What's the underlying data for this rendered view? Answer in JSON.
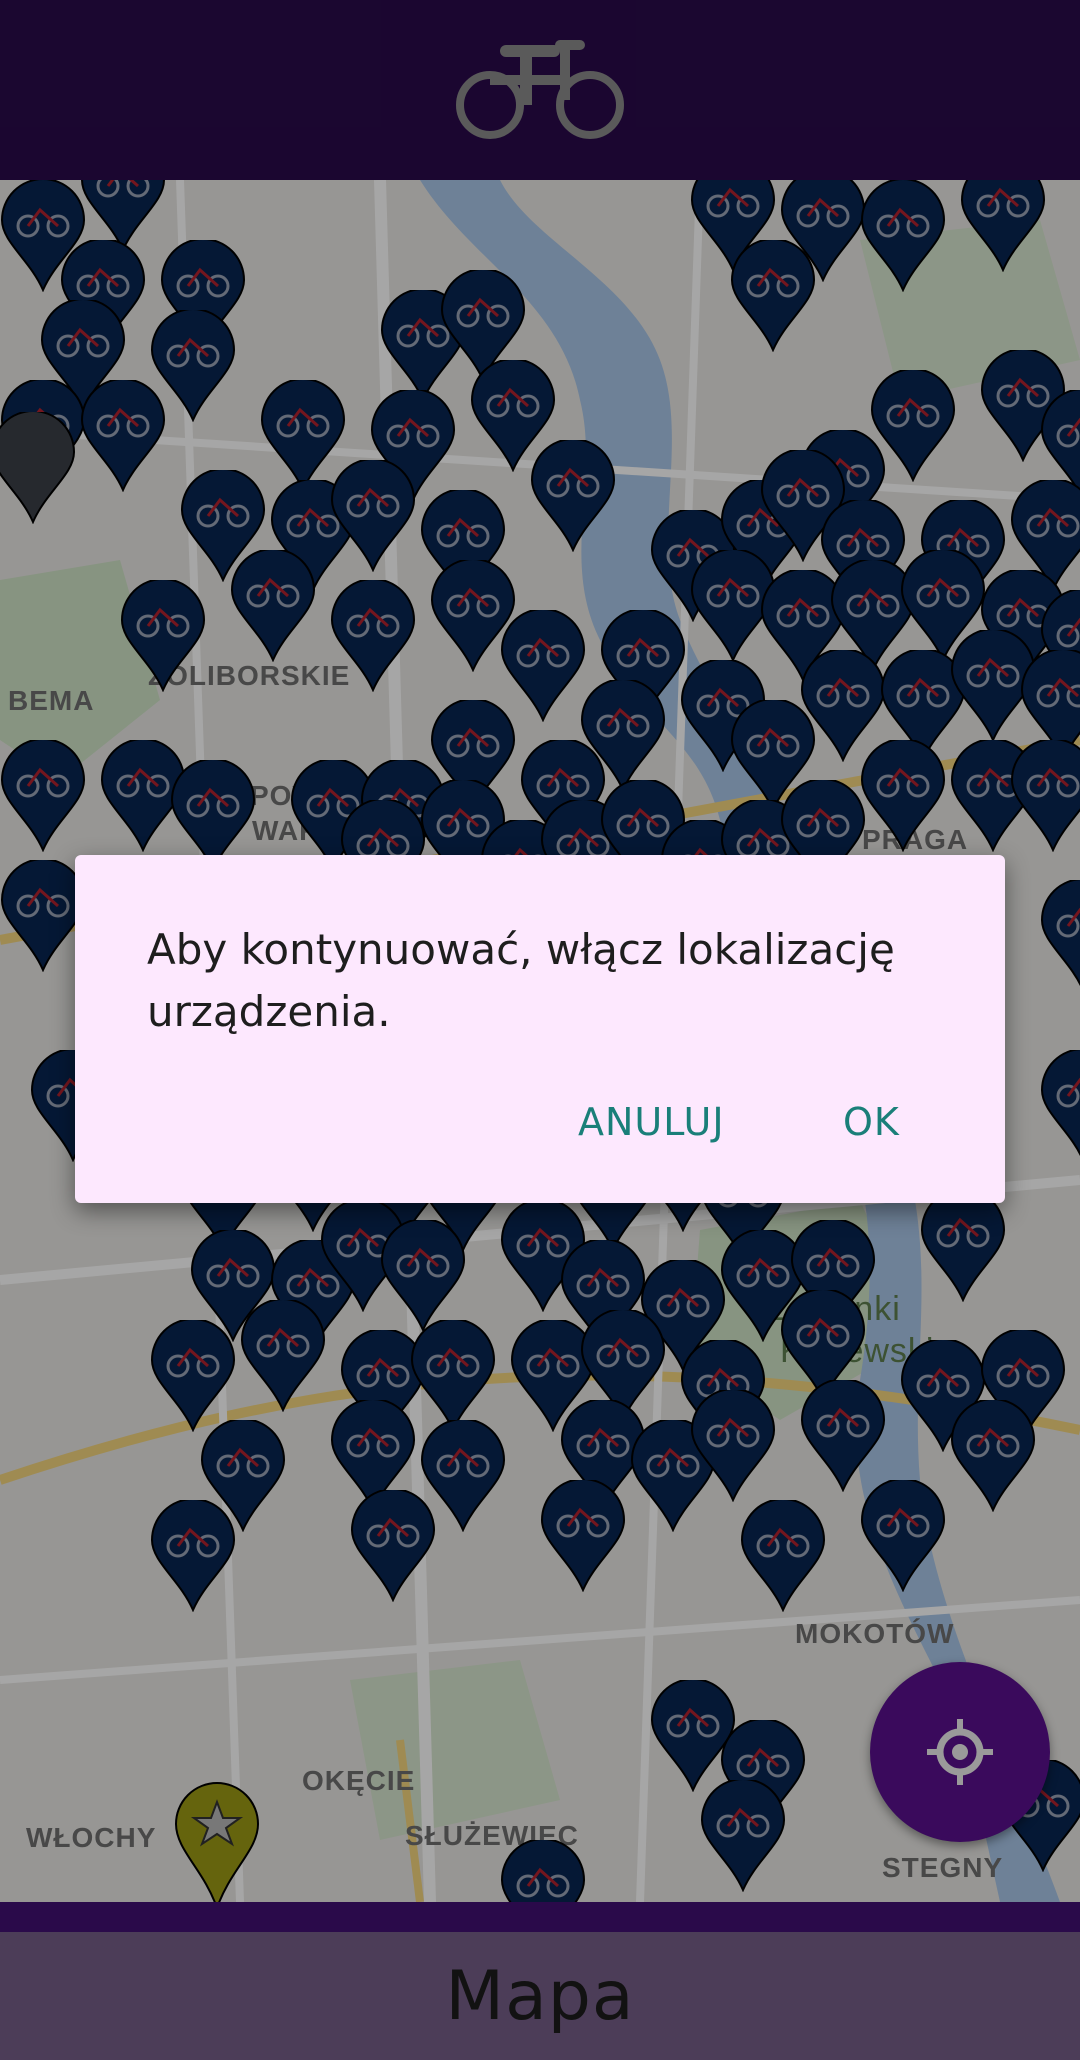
{
  "app": {
    "logo_icon": "bicycle-icon"
  },
  "map": {
    "labels": [
      "BEMA",
      "ŻOLIBORSKIE",
      "OKĘCIE",
      "WŁOCHY",
      "SŁUŻEWIEC",
      "STEGNY",
      "MOKOTÓW",
      "PRAGA",
      "Łazienki",
      "Królewskie",
      "POWIŚLE",
      "WARSZAWA"
    ],
    "station_icon": "bike-station-pin-icon",
    "favorite_icon": "star-pin-icon"
  },
  "dialog": {
    "message": "Aby kontynuować, włącz lokalizację urządzenia.",
    "cancel_label": "ANULUJ",
    "ok_label": "OK"
  },
  "fab": {
    "icon": "my-location-icon"
  },
  "bottom_nav": {
    "title": "Mapa"
  },
  "colors": {
    "primary": "#2a0a4a",
    "dialog_bg": "#fde8fe",
    "accent": "#1a7f79",
    "pin": "#082552"
  }
}
